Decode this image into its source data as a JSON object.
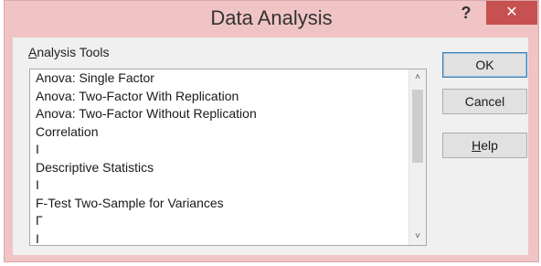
{
  "window": {
    "title": "Data Analysis",
    "help_glyph": "?",
    "close_glyph": "✕"
  },
  "group": {
    "label_prefix": "",
    "label_accel": "A",
    "label_rest": "nalysis Tools"
  },
  "list": {
    "items": [
      "Anova: Single Factor",
      "Anova: Two-Factor With Replication",
      "Anova: Two-Factor Without Replication",
      "Correlation",
      "I",
      "Descriptive Statistics",
      "I",
      "F-Test Two-Sample for Variances",
      "Γ",
      "I"
    ]
  },
  "scrollbar": {
    "up_glyph": "˄",
    "down_glyph": "˅"
  },
  "buttons": {
    "ok_label": "OK",
    "cancel_label": "Cancel",
    "help_accel": "H",
    "help_rest": "elp"
  },
  "colors": {
    "title_bar": "#f0c4c4",
    "close_button": "#c75050",
    "client_bg": "#f0f0f0"
  }
}
